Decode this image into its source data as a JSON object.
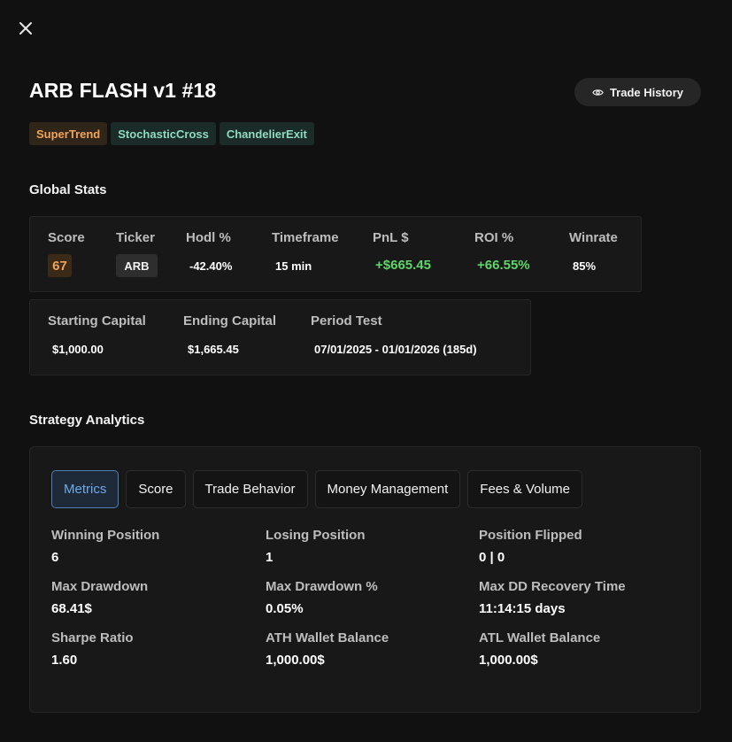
{
  "header": {
    "title": "ARB FLASH v1 #18",
    "trade_history_label": "Trade History"
  },
  "tags": [
    "SuperTrend",
    "StochasticCross",
    "ChandelierExit"
  ],
  "global_stats": {
    "heading": "Global Stats",
    "row1": {
      "score": {
        "label": "Score",
        "value": "67"
      },
      "ticker": {
        "label": "Ticker",
        "value": "ARB"
      },
      "hodl": {
        "label": "Hodl %",
        "value": "-42.40%"
      },
      "timeframe": {
        "label": "Timeframe",
        "value": "15 min"
      },
      "pnl": {
        "label": "PnL $",
        "value": "+$665.45"
      },
      "roi": {
        "label": "ROI %",
        "value": "+66.55%"
      },
      "winrate": {
        "label": "Winrate",
        "value": "85%"
      }
    },
    "row2": {
      "starting": {
        "label": "Starting Capital",
        "value": "$1,000.00"
      },
      "ending": {
        "label": "Ending Capital",
        "value": "$1,665.45"
      },
      "period": {
        "label": "Period Test",
        "value": "07/01/2025 - 01/01/2026 (185d)"
      }
    }
  },
  "analytics": {
    "heading": "Strategy Analytics",
    "tabs": [
      "Metrics",
      "Score",
      "Trade Behavior",
      "Money Management",
      "Fees & Volume"
    ],
    "active_tab": "Metrics",
    "metrics": [
      {
        "label": "Winning Position",
        "value": "6"
      },
      {
        "label": "Losing Position",
        "value": "1"
      },
      {
        "label": "Position Flipped",
        "value": "0 | 0"
      },
      {
        "label": "Max Drawdown",
        "value": "68.41$"
      },
      {
        "label": "Max Drawdown %",
        "value": "0.05%"
      },
      {
        "label": "Max DD Recovery Time",
        "value": "11:14:15 days"
      },
      {
        "label": "Sharpe Ratio",
        "value": "1.60"
      },
      {
        "label": "ATH Wallet Balance",
        "value": "1,000.00$"
      },
      {
        "label": "ATL Wallet Balance",
        "value": "1,000.00$"
      }
    ]
  },
  "colors": {
    "accent_blue": "#6ea9ea",
    "positive_green": "#5fd66a",
    "score_orange": "#f0a55a",
    "tag_teal": "#8fdbbf"
  },
  "icons": {
    "close": "close-icon",
    "trade_history": "eye-icon"
  }
}
